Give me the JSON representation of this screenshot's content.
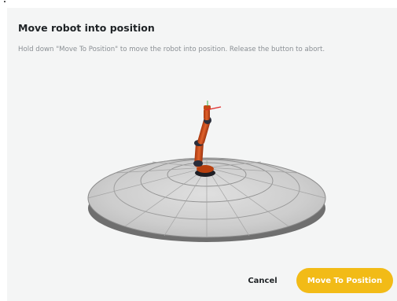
{
  "dialog": {
    "title": "Move robot into position",
    "description": "Hold down \"Move To Position\" to move the robot into position. Release the button to abort."
  },
  "scene": {
    "floor_icon": "turntable-grid-disc",
    "robot_icon": "robot-arm-model",
    "robot_color": "#d9531e",
    "joint_color": "#2a2d3a",
    "tool_axis_color": "#e02a2a"
  },
  "buttons": {
    "cancel_label": "Cancel",
    "move_label": "Move To Position",
    "move_color": "#f2bb17"
  }
}
